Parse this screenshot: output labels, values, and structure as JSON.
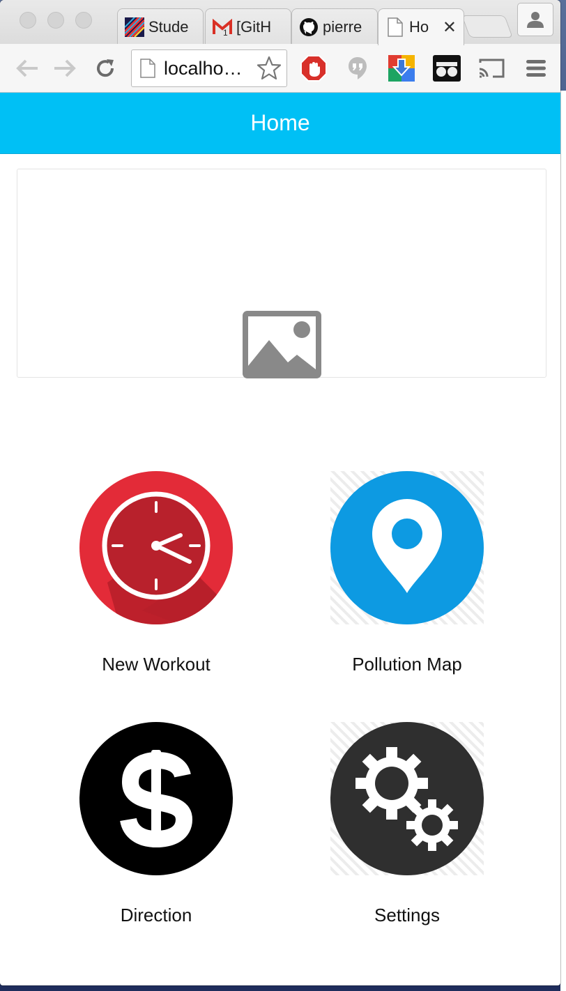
{
  "browser": {
    "tabs": [
      {
        "title": "Stude",
        "favicon": "colorful-stripes-icon"
      },
      {
        "title": "[GitH",
        "favicon": "gmail-icon",
        "badge": "1"
      },
      {
        "title": "pierre",
        "favicon": "github-icon"
      },
      {
        "title": "Ho",
        "favicon": "page-icon",
        "active": true
      }
    ],
    "address": "localho…",
    "extensions": [
      "adblock-icon",
      "hangouts-icon",
      "download-icon",
      "glasses-icon",
      "cast-icon",
      "menu-icon"
    ]
  },
  "app": {
    "header_title": "Home",
    "tiles": [
      {
        "label": "New Workout",
        "icon": "clock-icon",
        "color": "#e32b38"
      },
      {
        "label": "Pollution Map",
        "icon": "map-pin-icon",
        "color": "#0d9ae2"
      },
      {
        "label": "Direction",
        "icon": "dollar-icon",
        "color": "#000000"
      },
      {
        "label": "Settings",
        "icon": "gears-icon",
        "color": "#2f2f2f"
      }
    ]
  },
  "colors": {
    "header": "#00c0f5"
  }
}
